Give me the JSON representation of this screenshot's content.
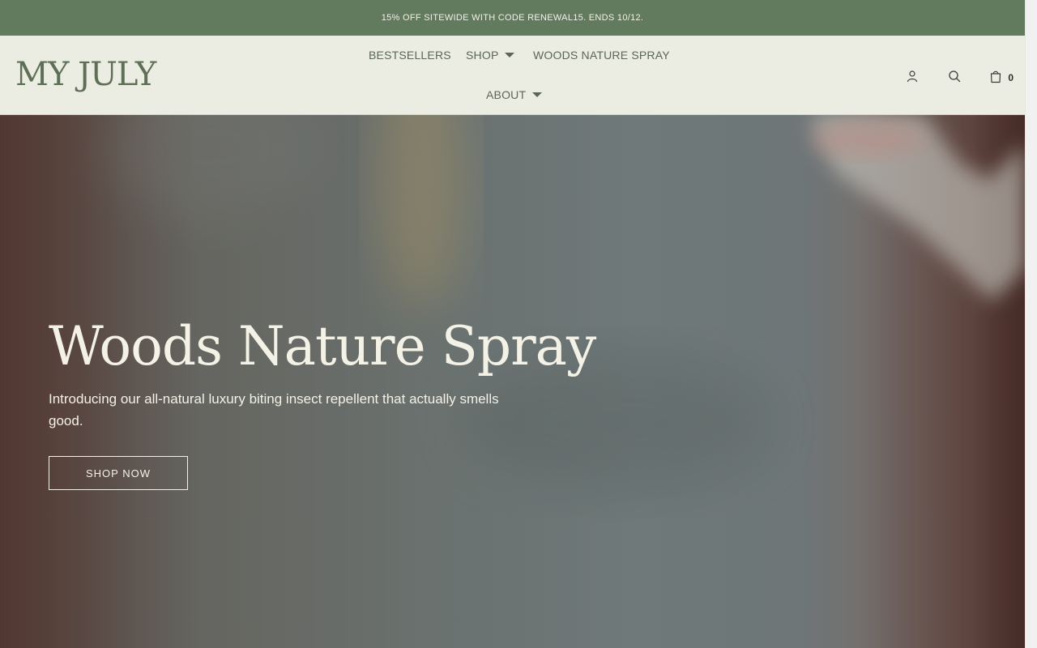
{
  "announcement": {
    "text": "15% OFF SITEWIDE WITH CODE RENEWAL15. ENDS 10/12."
  },
  "header": {
    "logo_text": "MY JULY",
    "nav": {
      "bestsellers": "BESTSELLERS",
      "shop": "SHOP",
      "woods_spray": "WOODS NATURE SPRAY",
      "about": "ABOUT"
    },
    "icons": {
      "account": "user-icon",
      "search": "search-icon",
      "cart": "shopping-bag-icon"
    },
    "cart_count": "0"
  },
  "hero": {
    "title": "Woods Nature Spray",
    "subtitle": "Introducing our all-natural luxury biting insect repellent that actually smells good.",
    "cta_label": "SHOP NOW"
  },
  "colors": {
    "announcement_bg": "#627a5d",
    "header_bg": "#ebede2",
    "brand_green": "#5f6f56",
    "hero_text": "#f4f1e6"
  }
}
